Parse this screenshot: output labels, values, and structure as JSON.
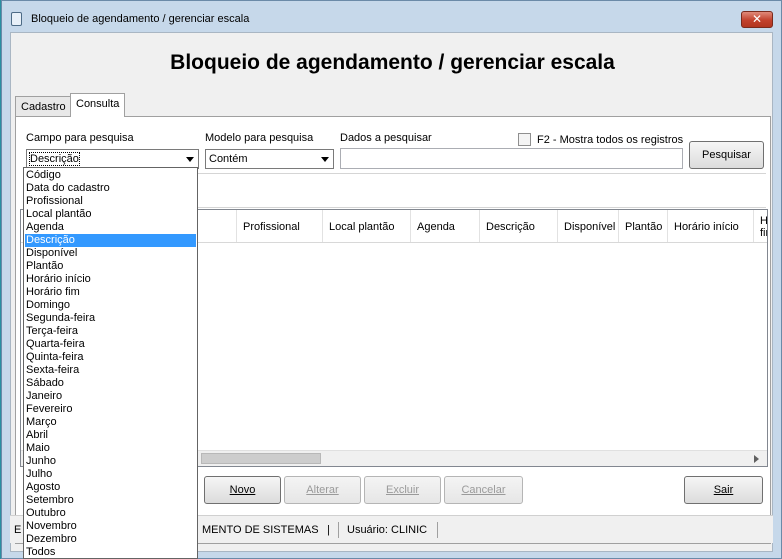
{
  "window": {
    "title": "Bloqueio de agendamento / gerenciar escala",
    "close_glyph": "✕",
    "heading": "Bloqueio de agendamento / gerenciar escala"
  },
  "tabs": [
    {
      "label": "Cadastro",
      "active": false
    },
    {
      "label": "Consulta",
      "active": true
    }
  ],
  "search": {
    "campo_label": "Campo para pesquisa",
    "campo_value": "Descrição",
    "modelo_label": "Modelo para pesquisa",
    "modelo_value": "Contém",
    "dados_label": "Dados a pesquisar",
    "dados_value": "",
    "show_all_label": "F2 - Mostra todos os registros",
    "show_all_checked": false,
    "search_button": "Pesquisar"
  },
  "grid": {
    "columns": [
      {
        "label": "Profissional"
      },
      {
        "label": "Local plantão"
      },
      {
        "label": "Agenda"
      },
      {
        "label": "Descrição"
      },
      {
        "label": "Disponível"
      },
      {
        "label": "Plantão"
      },
      {
        "label": "Horário início"
      },
      {
        "label": "Horário fim"
      }
    ],
    "rows": []
  },
  "buttons": {
    "novo": "Novo",
    "alterar": "Alterar",
    "excluir": "Excluir",
    "cancelar": "Cancelar",
    "sair": "Sair"
  },
  "status": {
    "left": "E",
    "company": "MENTO DE SISTEMAS",
    "pipe": "|",
    "user": "Usuário: CLINIC"
  },
  "dropdown": {
    "selected_index": 5,
    "options": [
      "Código",
      "Data do cadastro",
      "Profissional",
      "Local plantão",
      "Agenda",
      "Descrição",
      "Disponível",
      "Plantão",
      "Horário início",
      "Horário fim",
      "Domingo",
      "Segunda-feira",
      "Terça-feira",
      "Quarta-feira",
      "Quinta-feira",
      "Sexta-feira",
      "Sábado",
      "Janeiro",
      "Fevereiro",
      "Março",
      "Abril",
      "Maio",
      "Junho",
      "Julho",
      "Agosto",
      "Setembro",
      "Outubro",
      "Novembro",
      "Dezembro",
      "Todos"
    ]
  },
  "icons": {
    "app": "app-window-icon",
    "close": "close-icon",
    "combo_arrow": "chevron-down-icon",
    "scroll_right": "arrow-right-icon"
  },
  "colors": {
    "selection": "#3399ff",
    "close_button": "#c2412c",
    "frame": "#c6d8ea"
  }
}
